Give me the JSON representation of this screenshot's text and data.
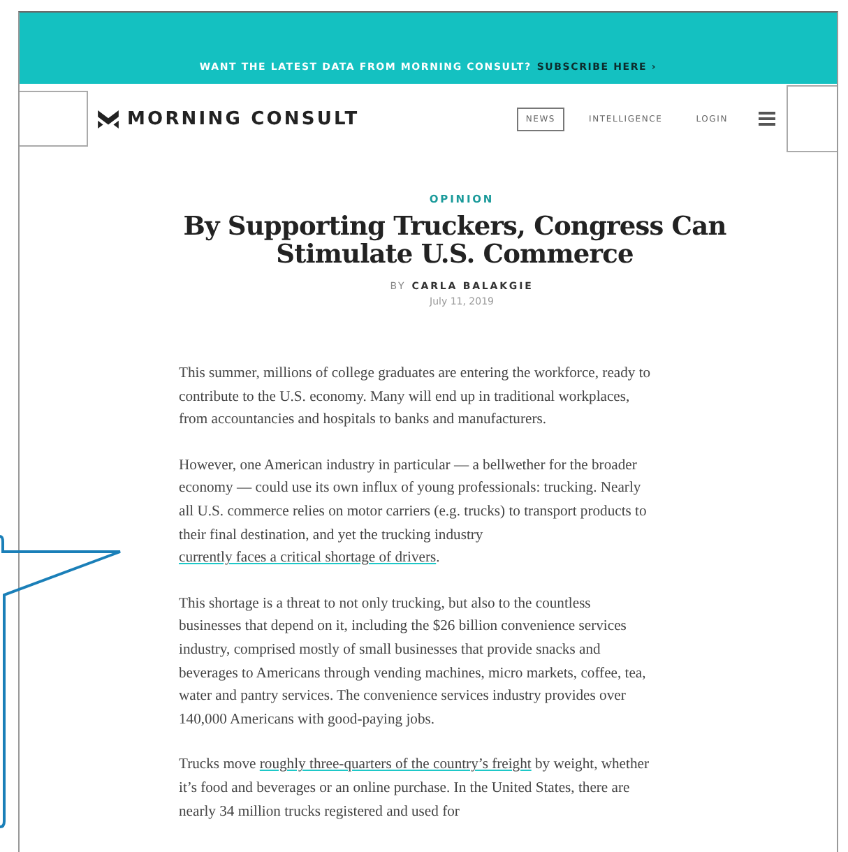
{
  "banner": {
    "text": "WANT THE LATEST DATA FROM MORNING CONSULT?",
    "link": "SUBSCRIBE HERE ›"
  },
  "header": {
    "logo": "MORNING CONSULT",
    "nav": [
      {
        "label": "NEWS",
        "selected": true
      },
      {
        "label": "INTELLIGENCE",
        "selected": false
      },
      {
        "label": "LOGIN",
        "selected": false
      }
    ]
  },
  "article": {
    "section": "OPINION",
    "title": "By Supporting Truckers, Congress Can Stimulate U.S. Commerce",
    "byline_prefix": "BY",
    "author": "CARLA BALAKGIE",
    "date": "July 11, 2019",
    "paragraphs": [
      [
        {
          "text": "This summer, millions of college graduates are entering the workforce, ready to contribute to the U.S. economy. Many will end up in traditional workplaces, from accountancies and hospitals to banks and manufacturers.",
          "link": false
        }
      ],
      [
        {
          "text": "However, one American industry in particular — a bellwether for the broader economy — could use its own influx of young professionals: trucking. Nearly all U.S. commerce relies on motor carriers (e.g. trucks) to transport products to their final destination, and yet the trucking industry ",
          "link": false
        },
        {
          "text": "currently faces a critical shortage of drivers",
          "link": true
        },
        {
          "text": ".",
          "link": false
        }
      ],
      [
        {
          "text": "This shortage is a threat to not only trucking, but also to the countless businesses that depend on it, including the $26 billion convenience services industry, comprised mostly of small businesses that provide snacks and beverages to Americans through vending machines, micro markets, coffee, tea, water and pantry services. The convenience services industry provides over 140,000 Americans with good-paying jobs.",
          "link": false
        }
      ],
      [
        {
          "text": "Trucks move ",
          "link": false
        },
        {
          "text": "roughly three-quarters of the country’s freight",
          "link": true
        },
        {
          "text": " by weight, whether it’s food and beverages or an online purchase. In the United States, there are nearly 34 million trucks registered and used for",
          "link": false
        }
      ]
    ]
  }
}
